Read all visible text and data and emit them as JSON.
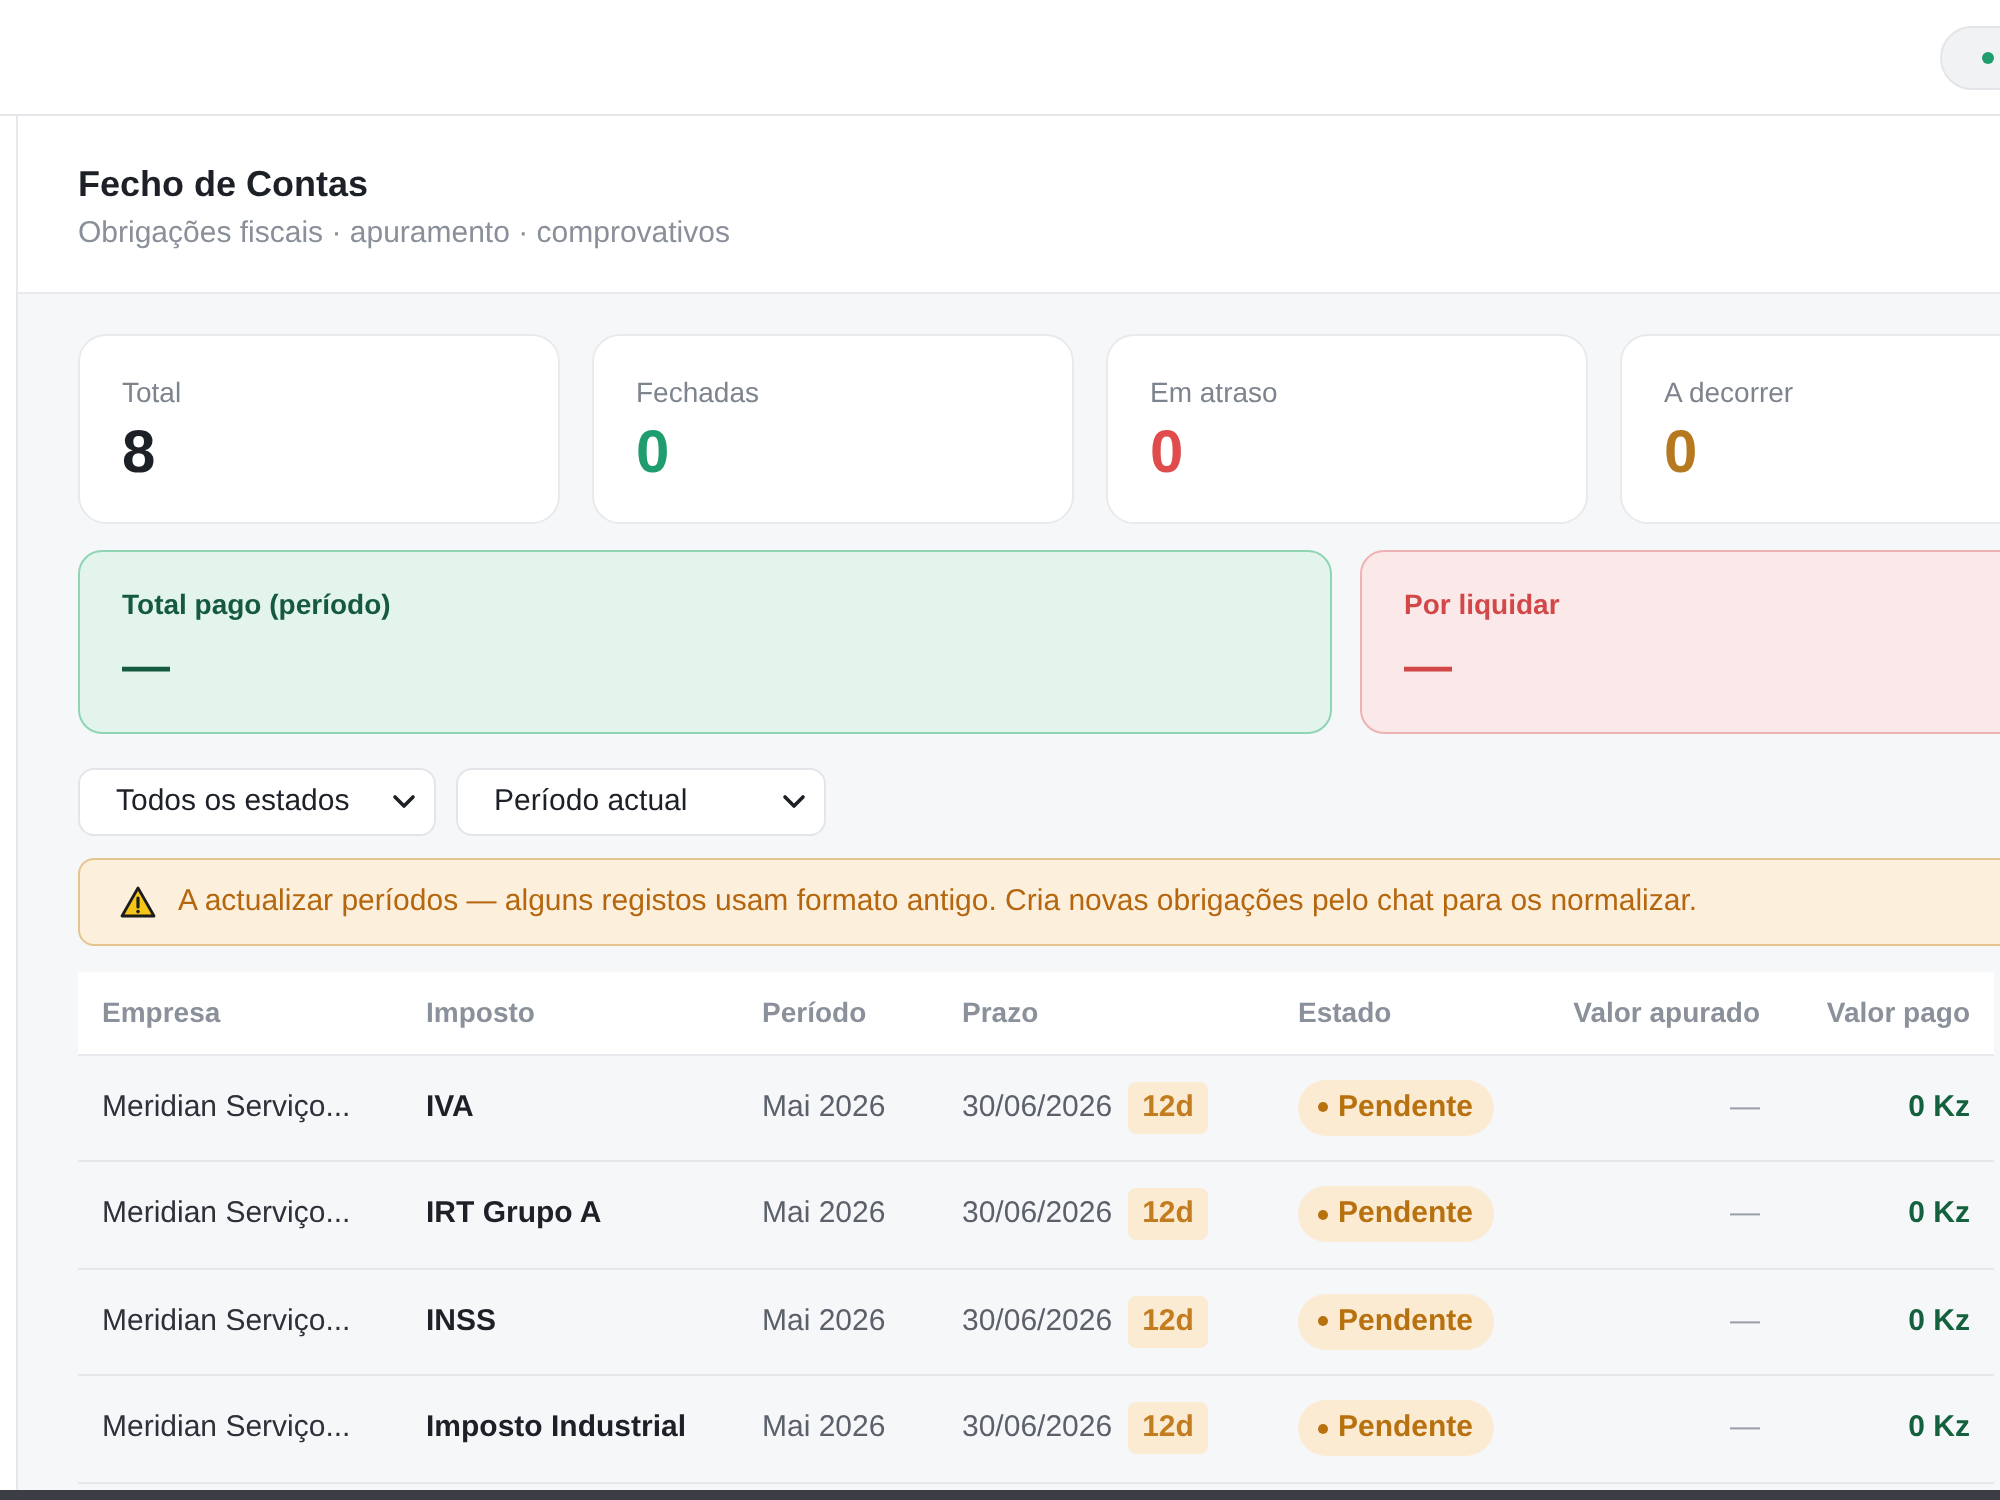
{
  "header": {
    "title": "Fecho de Contas",
    "subtitle": "Obrigações fiscais · apuramento · comprovativos"
  },
  "stats": [
    {
      "label": "Total",
      "value": "8",
      "color": "#1d2127"
    },
    {
      "label": "Fechadas",
      "value": "0",
      "color": "#1f9d6f"
    },
    {
      "label": "Em atraso",
      "value": "0",
      "color": "#e04b4b"
    },
    {
      "label": "A decorrer",
      "value": "0",
      "color": "#b7791f"
    }
  ],
  "totals": [
    {
      "kind": "paid",
      "label": "Total pago (período)",
      "value": "—"
    },
    {
      "kind": "due",
      "label": "Por liquidar",
      "value": "—"
    }
  ],
  "filters": [
    {
      "value": "Todos os estados"
    },
    {
      "value": "Período actual"
    }
  ],
  "warning": {
    "text": "A actualizar períodos — alguns registos usam formato antigo. Cria novas obrigações pelo chat para os normalizar."
  },
  "table": {
    "columns": [
      "Empresa",
      "Imposto",
      "Período",
      "Prazo",
      "Estado",
      "Valor apurado",
      "Valor pago"
    ],
    "rows": [
      {
        "empresa": "Meridian Serviço...",
        "imposto": "IVA",
        "periodo": "Mai 2026",
        "prazo": "30/06/2026",
        "days_left": "12d",
        "estado": {
          "label": "Pendente",
          "kind": "pending"
        },
        "valor_apurado": "—",
        "valor_pago": "0 Kz"
      },
      {
        "empresa": "Meridian Serviço...",
        "imposto": "IRT Grupo A",
        "periodo": "Mai 2026",
        "prazo": "30/06/2026",
        "days_left": "12d",
        "estado": {
          "label": "Pendente",
          "kind": "pending"
        },
        "valor_apurado": "—",
        "valor_pago": "0 Kz"
      },
      {
        "empresa": "Meridian Serviço...",
        "imposto": "INSS",
        "periodo": "Mai 2026",
        "prazo": "30/06/2026",
        "days_left": "12d",
        "estado": {
          "label": "Pendente",
          "kind": "pending"
        },
        "valor_apurado": "—",
        "valor_pago": "0 Kz"
      },
      {
        "empresa": "Meridian Serviço...",
        "imposto": "Imposto Industrial",
        "periodo": "Mai 2026",
        "prazo": "30/06/2026",
        "days_left": "12d",
        "estado": {
          "label": "Pendente",
          "kind": "pending"
        },
        "valor_apurado": "—",
        "valor_pago": "0 Kz"
      }
    ]
  }
}
